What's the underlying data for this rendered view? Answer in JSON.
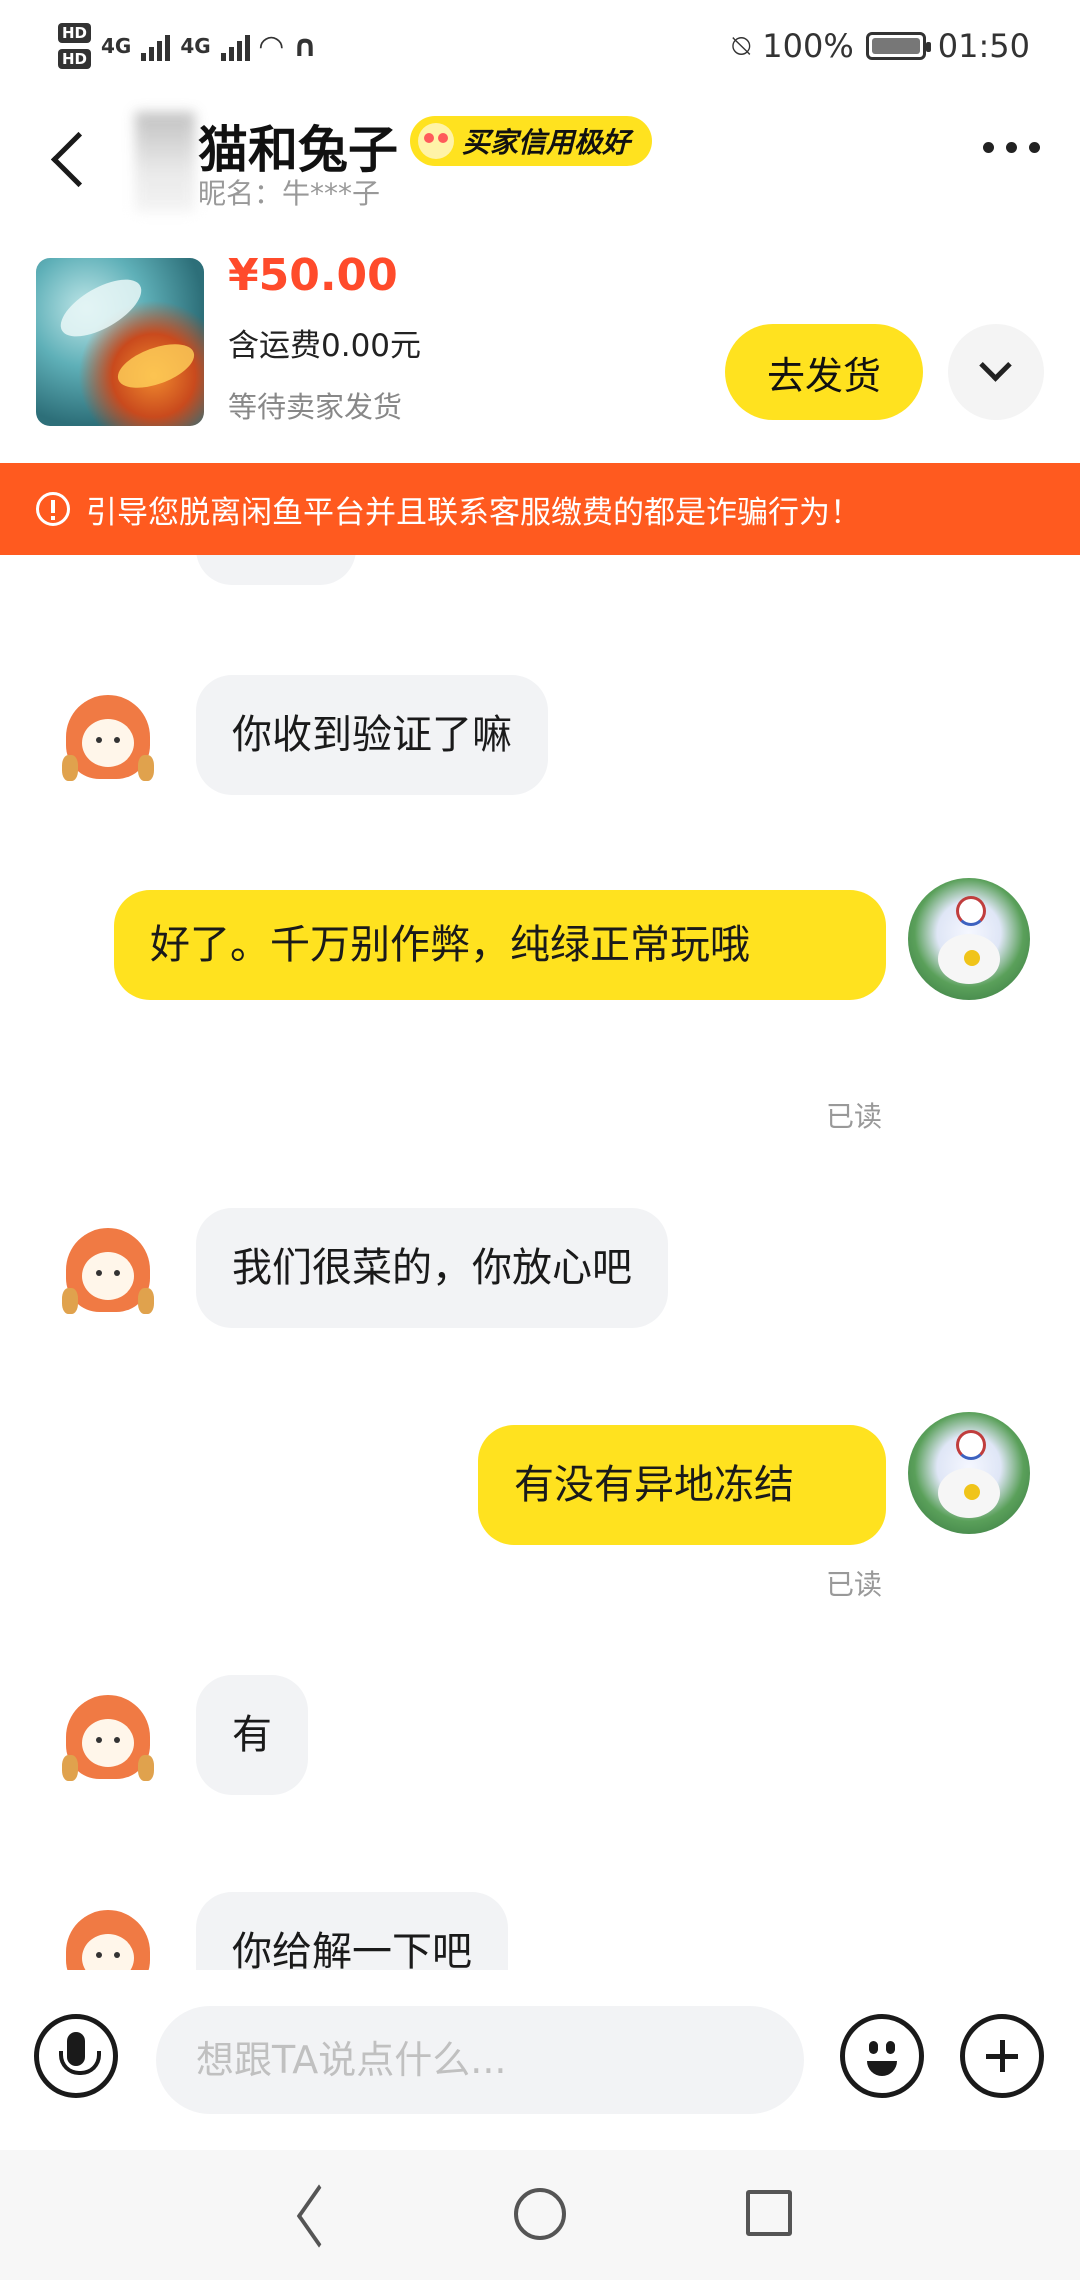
{
  "status_bar": {
    "hd1": "HD",
    "hd2": "HD",
    "net1": "4G",
    "net2": "4G",
    "battery": "100%",
    "time": "01:50",
    "icons": [
      "hd-icon",
      "signal-icon",
      "wifi-icon",
      "headset-icon",
      "mute-bell-icon",
      "battery-icon"
    ]
  },
  "header": {
    "title": "猫和兔子",
    "credit_badge": "买家信用极好",
    "nickname": "昵名：牛***子"
  },
  "product": {
    "price": "¥50.00",
    "shipping": "含运费0.00元",
    "status": "等待卖家发货",
    "ship_button": "去发货"
  },
  "warning": {
    "text": "引导您脱离闲鱼平台并且联系客服缴费的都是诈骗行为！"
  },
  "messages": [
    {
      "side": "in",
      "text": "你收到验证了嘛"
    },
    {
      "side": "out",
      "text": "好了。千万别作弊，纯绿正常玩哦",
      "read": "已读"
    },
    {
      "side": "in",
      "text": "我们很菜的，你放心吧"
    },
    {
      "side": "out",
      "text": "有没有异地冻结",
      "read": "已读"
    },
    {
      "side": "in",
      "text": "有"
    },
    {
      "side": "in",
      "text": "你给解一下吧"
    }
  ],
  "input": {
    "placeholder": "想跟TA说点什么..."
  },
  "colors": {
    "accent_yellow": "#ffe21f",
    "warning_orange": "#ff5a1f",
    "price_red": "#ff4b2b"
  }
}
